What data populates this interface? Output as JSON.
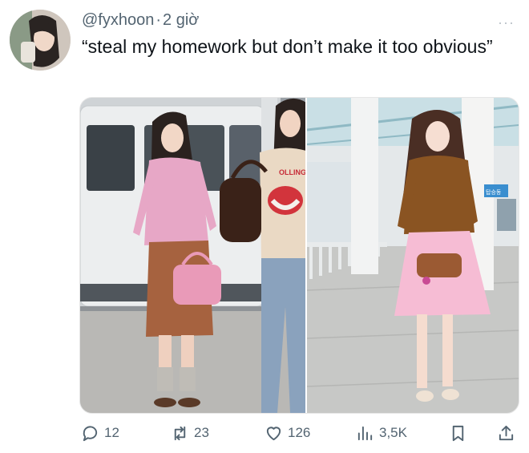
{
  "tweet": {
    "handle": "@fyxhoon",
    "separator": "·",
    "time": "2 giờ",
    "more_label": "···",
    "text": "“steal my homework but don’t make it too obvious”"
  },
  "photo_text": {
    "shirt_print": "OLLING STONES",
    "wall_sign": "탑승동"
  },
  "actions": {
    "replies": "12",
    "reposts": "23",
    "likes": "126",
    "views": "3,5K"
  },
  "icons": [
    "reply-icon",
    "repost-icon",
    "like-icon",
    "views-icon",
    "bookmark-icon",
    "share-icon"
  ]
}
